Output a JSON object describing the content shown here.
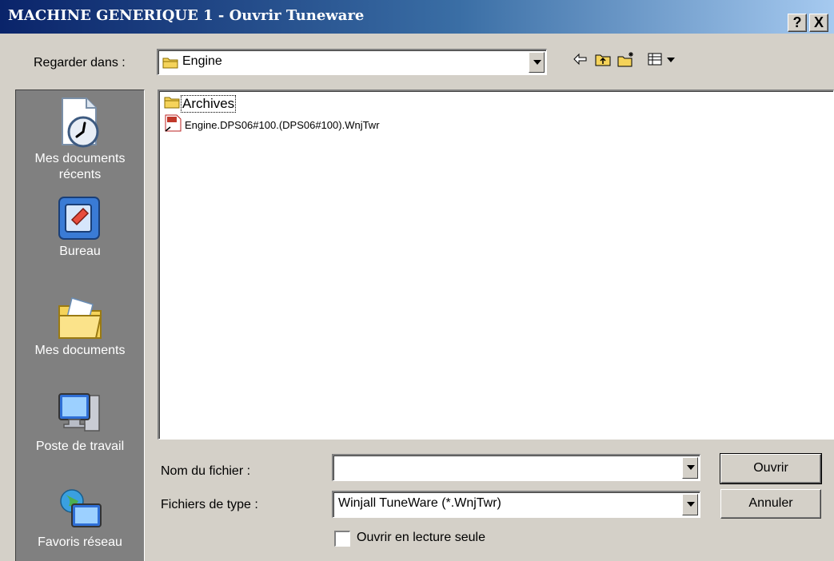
{
  "window": {
    "title": "MACHINE GENERIQUE 1 - Ouvrir Tuneware",
    "help_label": "?",
    "close_label": "X"
  },
  "look_in": {
    "label": "Regarder dans :",
    "value": "Engine"
  },
  "toolbar": {
    "back_icon": "back-arrow-icon",
    "up_icon": "up-folder-icon",
    "new_folder_icon": "new-folder-icon",
    "view_menu_icon": "view-menu-icon"
  },
  "places": [
    {
      "label": "Mes documents récents",
      "icon": "recent-documents-icon"
    },
    {
      "label": "Bureau",
      "icon": "desktop-icon"
    },
    {
      "label": "Mes documents",
      "icon": "my-documents-icon"
    },
    {
      "label": "Poste de travail",
      "icon": "my-computer-icon"
    },
    {
      "label": "Favoris réseau",
      "icon": "network-places-icon"
    }
  ],
  "files": [
    {
      "name": "Archives",
      "type": "folder"
    },
    {
      "name": "Engine.DPS06#100.(DPS06#100).WnjTwr",
      "type": "tuneware-file"
    }
  ],
  "filename": {
    "label": "Nom du fichier :",
    "value": ""
  },
  "filetype": {
    "label": "Fichiers de type :",
    "value": "Winjall TuneWare (*.WnjTwr)"
  },
  "readonly": {
    "label": "Ouvrir en lecture seule",
    "checked": false
  },
  "buttons": {
    "open": "Ouvrir",
    "cancel": "Annuler"
  },
  "colors": {
    "title_start": "#0a246a",
    "title_end": "#a6caf0",
    "face": "#d4d0c8",
    "places_bar": "#808080"
  }
}
